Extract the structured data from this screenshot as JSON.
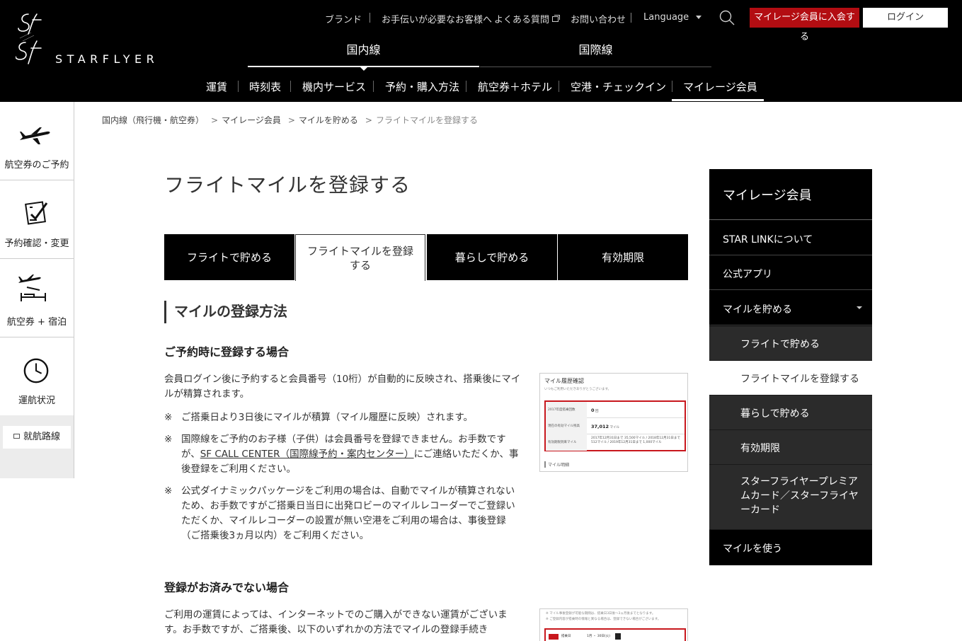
{
  "brand": {
    "name": "STARFLYER"
  },
  "header": {
    "utility": [
      {
        "label": "ブランド"
      },
      {
        "label": "お手伝いが必要なお客様へ"
      },
      {
        "label": "よくある質問"
      },
      {
        "label": "お問い合わせ"
      },
      {
        "label": "Language"
      }
    ],
    "join_label": "マイレージ会員に入会する",
    "login_label": "ログイン",
    "main_tabs": [
      {
        "label": "国内線",
        "active": true
      },
      {
        "label": "国際線",
        "active": false
      }
    ],
    "subnav": [
      {
        "label": "運賃"
      },
      {
        "label": "時刻表"
      },
      {
        "label": "機内サービス"
      },
      {
        "label": "予約・購入方法"
      },
      {
        "label": "航空券＋ホテル"
      },
      {
        "label": "空港・チェックイン"
      },
      {
        "label": "マイレージ会員",
        "active": true
      }
    ]
  },
  "sidenav": {
    "items": [
      {
        "label": "航空券のご予約",
        "icon": "airplane-icon"
      },
      {
        "label": "予約確認・変更",
        "icon": "checklist-icon"
      },
      {
        "label": "航空券 + 宿泊",
        "icon": "plane-bed-icon"
      },
      {
        "label": "運航状況",
        "icon": "clock-icon"
      }
    ],
    "routes_label": "就航路線"
  },
  "breadcrumb": [
    {
      "label": "国内線（飛行機・航空券）"
    },
    {
      "label": "マイレージ会員"
    },
    {
      "label": "マイルを貯める"
    },
    {
      "label": "フライトマイルを登録する"
    }
  ],
  "breadcrumb_separator": ">",
  "page": {
    "title": "フライトマイルを登録する",
    "tabs": [
      {
        "label": "フライトで貯める"
      },
      {
        "label": "フライトマイルを登録する",
        "active": true
      },
      {
        "label": "暮らしで貯める"
      },
      {
        "label": "有効期限"
      }
    ],
    "section_heading": "マイルの登録方法",
    "sub1": {
      "heading": "ご予約時に登録する場合",
      "body": "会員ログイン後に予約すると会員番号（10桁）が自動的に反映され、搭乗後にマイルが精算されます。",
      "note_mark": "※",
      "note1": "ご搭乗日より3日後にマイルが積算（マイル履歴に反映）されます。",
      "note2_before": "国際線をご予約のお子様（子供）は会員番号を登録できません。お手数ですが、",
      "note2_link": "SF CALL CENTER（国際線予約・案内センター）",
      "note2_after": "にご連絡いただくか、事後登録をご利用ください。",
      "note3": "公式ダイナミックパッケージをご利用の場合は、自動でマイルが積算されないため、お手数ですがご搭乗日当日に出発ロビーのマイルレコーダーでご登録いただくか、マイルレコーダーの設置が無い空港をご利用の場合は、事後登録（ご搭乗後3ヵ月以内）をご利用ください。"
    },
    "sub2": {
      "heading": "登録がお済みでない場合",
      "body": "ご利用の運賃によっては、インターネットでのご購入ができない運賃がございます。お手数ですが、ご搭乗後、以下のいずれかの方法でマイルの登録手続き"
    },
    "thumb1": {
      "title": "マイル履歴確認",
      "subtitle": "いつもご利用いただきありがとうございます。",
      "rows": [
        {
          "key": "2017年度搭乗回数",
          "value": "0",
          "unit": "回"
        },
        {
          "key": "現在の有効マイル残高",
          "value": "37,012",
          "unit": "マイル"
        },
        {
          "key": "有効期限到来マイル",
          "value": "2017年12月31日まで 35,500マイル / 2018年12月31日まで 512マイル / 2019年12月31日まで 1,000マイル"
        }
      ],
      "footer": "マイル明細"
    },
    "thumb2": {
      "line1": "※ マイル事後登録が可能な期間は、搭乗日3日後～3ヵ月後までとなります。",
      "line2": "※ ご登録内容が搭乗時の情報と異なる場合は、登録できない場合がございます。",
      "tag_key": "搭乗日",
      "tag_value": "1月 ・ 30日(火)"
    }
  },
  "rmenu": {
    "head": "マイレージ会員",
    "items": [
      {
        "label": "STAR LINKについて"
      },
      {
        "label": "公式アプリ"
      },
      {
        "label": "マイルを貯める",
        "open": true
      }
    ],
    "subitems": [
      {
        "label": "フライトで貯める"
      },
      {
        "label": "フライトマイルを登録する",
        "active": true
      },
      {
        "label": "暮らしで貯める"
      },
      {
        "label": "有効期限"
      },
      {
        "label": "スターフライヤープレミアムカード／スターフライヤーカード"
      }
    ],
    "last": {
      "label": "マイルを使う"
    }
  },
  "colors": {
    "header_bg": "#000000",
    "join_button": "#b30d12",
    "accent_red": "#c8171d",
    "submenu_bg": "#2b2b2b"
  }
}
